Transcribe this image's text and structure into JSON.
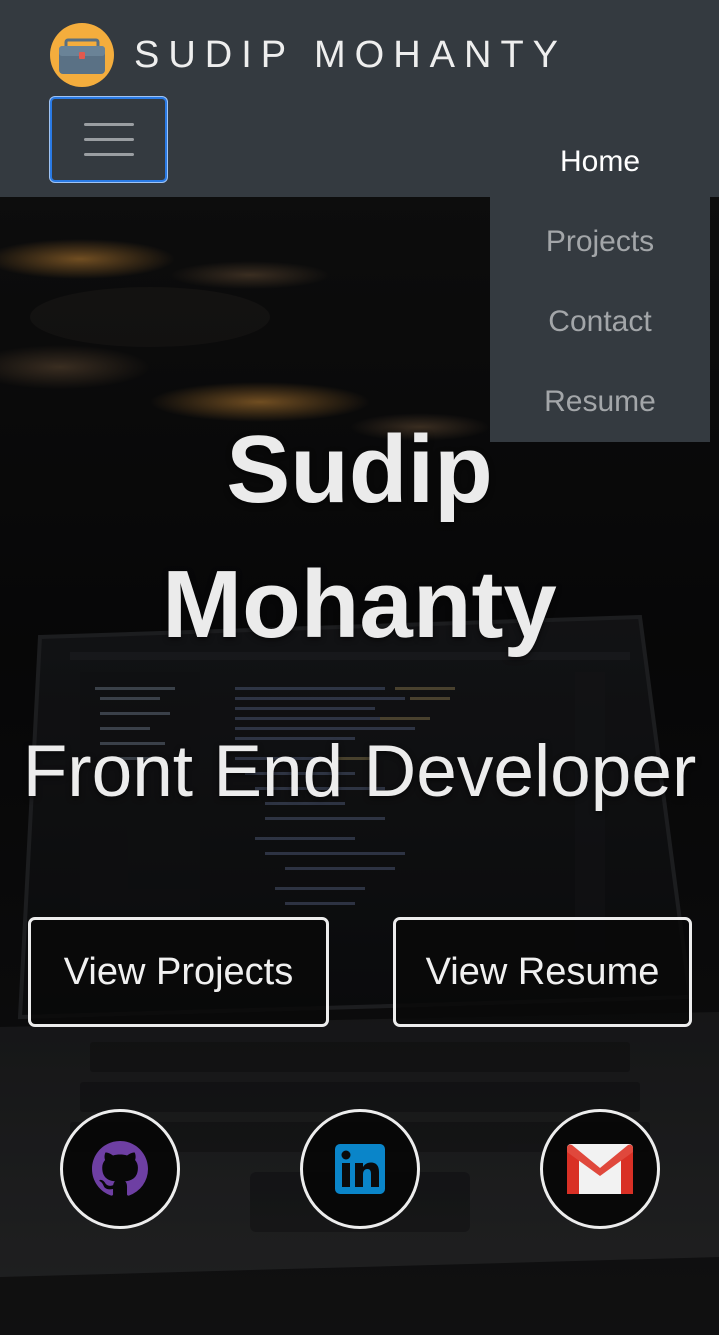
{
  "brand": {
    "name": "SUDIP MOHANTY",
    "logo_icon": "briefcase-icon",
    "logo_color": "#f4ad3d"
  },
  "navbar": {
    "background": "#343a40",
    "toggler_icon": "hamburger-menu-icon",
    "menu": [
      {
        "label": "Home",
        "active": true
      },
      {
        "label": "Projects",
        "active": false
      },
      {
        "label": "Contact",
        "active": false
      },
      {
        "label": "Resume",
        "active": false
      }
    ]
  },
  "hero": {
    "name": "Sudip Mohanty",
    "subtitle": "Front End Developer",
    "buttons": {
      "projects": "View Projects",
      "resume": "View Resume"
    },
    "social": [
      {
        "name": "github",
        "icon": "github-icon",
        "color": "#6e3fa3"
      },
      {
        "name": "linkedin",
        "icon": "linkedin-icon",
        "color": "#0a85c9"
      },
      {
        "name": "gmail",
        "icon": "gmail-icon",
        "color": "#d93025"
      }
    ]
  }
}
